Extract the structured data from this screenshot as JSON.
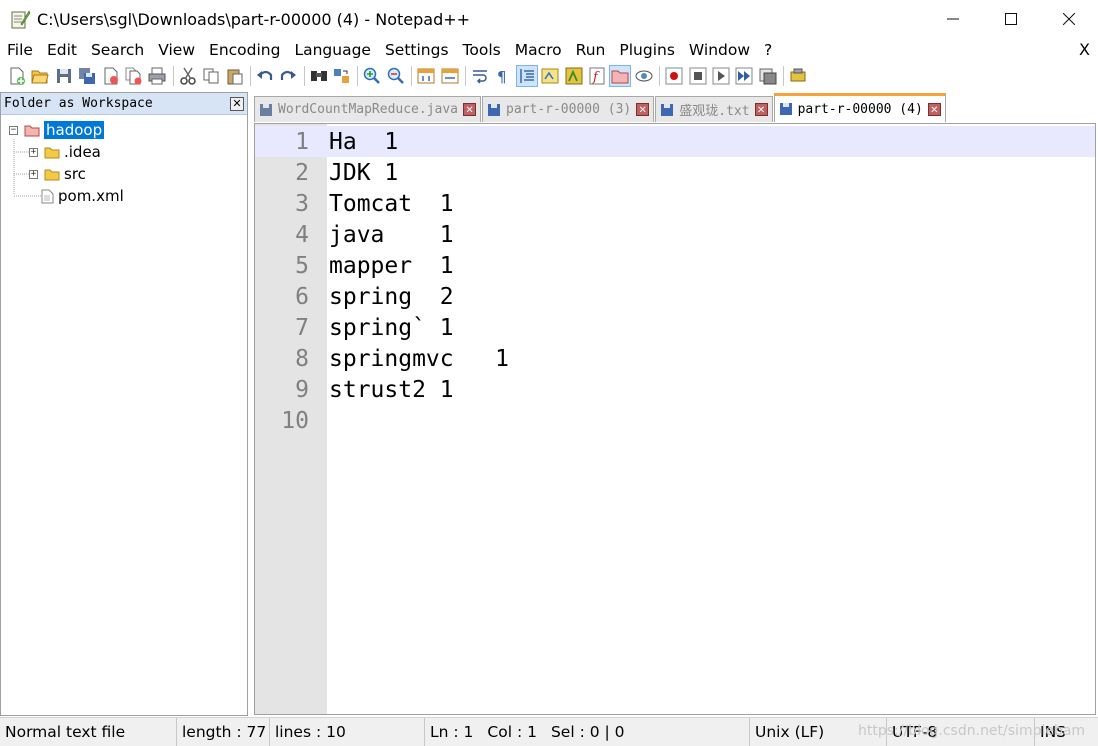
{
  "window": {
    "title": "C:\\Users\\sgl\\Downloads\\part-r-00000 (4) - Notepad++",
    "minimize": "—",
    "maximize": "☐",
    "close": "✕"
  },
  "menu": {
    "items": [
      "File",
      "Edit",
      "Search",
      "View",
      "Encoding",
      "Language",
      "Settings",
      "Tools",
      "Macro",
      "Run",
      "Plugins",
      "Window",
      "?"
    ],
    "close": "X"
  },
  "panel": {
    "title": "Folder as Workspace",
    "close": "✕",
    "tree": {
      "root": "hadoop",
      "children": [
        {
          "name": ".idea",
          "type": "folder",
          "expander": "+"
        },
        {
          "name": "src",
          "type": "folder",
          "expander": "+"
        },
        {
          "name": "pom.xml",
          "type": "file"
        }
      ],
      "root_expander": "−"
    }
  },
  "tabs": [
    {
      "label": "WordCountMapReduce.java",
      "active": false
    },
    {
      "label": "part-r-00000 (3)",
      "active": false
    },
    {
      "label": "盛观珑.txt",
      "active": false
    },
    {
      "label": "part-r-00000 (4)",
      "active": true
    }
  ],
  "tab_close": "✕",
  "editor": {
    "lines": [
      {
        "n": "1",
        "text": "Ha  1"
      },
      {
        "n": "2",
        "text": "JDK 1"
      },
      {
        "n": "3",
        "text": "Tomcat  1"
      },
      {
        "n": "4",
        "text": "java    1"
      },
      {
        "n": "5",
        "text": "mapper  1"
      },
      {
        "n": "6",
        "text": "spring  2"
      },
      {
        "n": "7",
        "text": "spring` 1"
      },
      {
        "n": "8",
        "text": "springmvc   1"
      },
      {
        "n": "9",
        "text": "strust2 1"
      },
      {
        "n": "10",
        "text": ""
      }
    ],
    "current_line": 1
  },
  "status": {
    "filetype": "Normal text file",
    "length": "length : 77",
    "lines": "lines : 10",
    "ln": "Ln : 1",
    "col": "Col : 1",
    "sel": "Sel : 0 | 0",
    "eol": "Unix (LF)",
    "encoding": "UTF-8",
    "mode": "INS",
    "watermark": "https://blog.csdn.net/simplebam"
  },
  "colors": {
    "accent_tab": "#f7a33a",
    "selection": "#0078d7",
    "current_line": "#e8e8ff",
    "panel_header": "#d6e4f5"
  }
}
